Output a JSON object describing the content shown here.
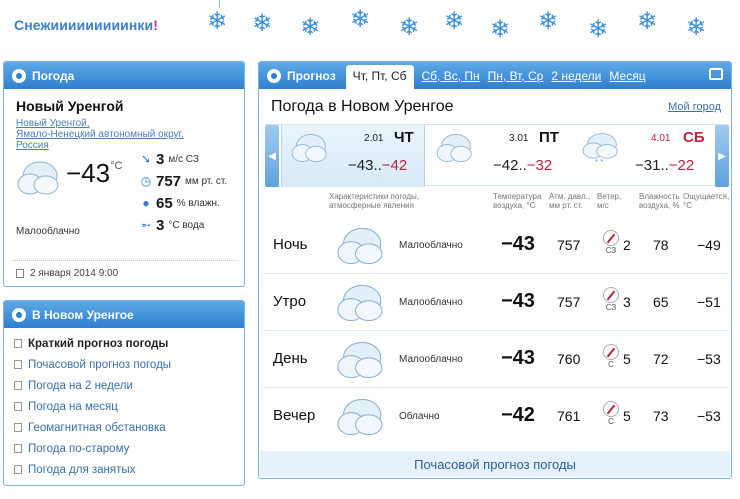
{
  "banner": {
    "title": "Снежииииииииинки",
    "bang": "!"
  },
  "weather_card": {
    "header": "Погода",
    "city": "Новый Уренгой",
    "region": [
      "Новый Уренгой,",
      "Ямало-Ненецкий автономный округ,",
      "Россия"
    ],
    "temperature": "−43",
    "temp_unit": "°C",
    "wind_value": "3",
    "wind_unit": "м/с  СЗ",
    "pressure_value": "757",
    "pressure_unit": "мм рт. ст.",
    "humidity_value": "65",
    "humidity_unit": "% влажн.",
    "water_value": "3",
    "water_unit": "°C вода",
    "condition": "Малооблачно",
    "date": "2 января 2014 9:00"
  },
  "links_card": {
    "header": "В Новом Уренгое",
    "items": [
      {
        "label": "Краткий прогноз погоды",
        "active": true
      },
      {
        "label": "Почасовой прогноз погоды"
      },
      {
        "label": "Погода на 2 недели"
      },
      {
        "label": "Погода на месяц"
      },
      {
        "label": "Геомагнитная обстановка"
      },
      {
        "label": "Погода по-старому"
      },
      {
        "label": "Погода для занятых"
      }
    ]
  },
  "forecast": {
    "header": "Прогноз",
    "tabs": [
      "Чт, Пт, Сб",
      "Сб, Вс, Пн",
      "Пн, Вт, Ср",
      "2 недели",
      "Месяц"
    ],
    "title": "Погода в Новом Уренгое",
    "my_city": "Мой город",
    "days": [
      {
        "date": "2.01",
        "name": "ЧТ",
        "day_temp": "−43..",
        "night_temp": "−42",
        "weekend": false
      },
      {
        "date": "3.01",
        "name": "ПТ",
        "day_temp": "−42..",
        "night_temp": "−32",
        "weekend": false
      },
      {
        "date": "4.01",
        "name": "СБ",
        "day_temp": "−31..",
        "night_temp": "−22",
        "weekend": true
      }
    ],
    "columns": {
      "weather": "Характеристики погоды,\nатмосферные явления",
      "temp": "Температура\nвоздуха, °C",
      "pressure": "Атм. давл.,\nмм рт. ст.",
      "wind": "Ветер,\nм/с",
      "humidity": "Влажность\nвоздуха, %",
      "feels": "Ощущается,\n°C"
    },
    "rows": [
      {
        "label": "Ночь",
        "condition": "Малооблачно",
        "temp": "−43",
        "pressure": "757",
        "wind_dir": "СЗ",
        "wind": "2",
        "humidity": "78",
        "feels": "−49"
      },
      {
        "label": "Утро",
        "condition": "Малооблачно",
        "temp": "−43",
        "pressure": "757",
        "wind_dir": "СЗ",
        "wind": "3",
        "humidity": "65",
        "feels": "−51"
      },
      {
        "label": "День",
        "condition": "Малооблачно",
        "temp": "−43",
        "pressure": "760",
        "wind_dir": "С",
        "wind": "5",
        "humidity": "72",
        "feels": "−53"
      },
      {
        "label": "Вечер",
        "condition": "Облачно",
        "temp": "−42",
        "pressure": "761",
        "wind_dir": "С",
        "wind": "5",
        "humidity": "73",
        "feels": "−53"
      }
    ],
    "bottom_link": "Почасовой прогноз погоды"
  }
}
